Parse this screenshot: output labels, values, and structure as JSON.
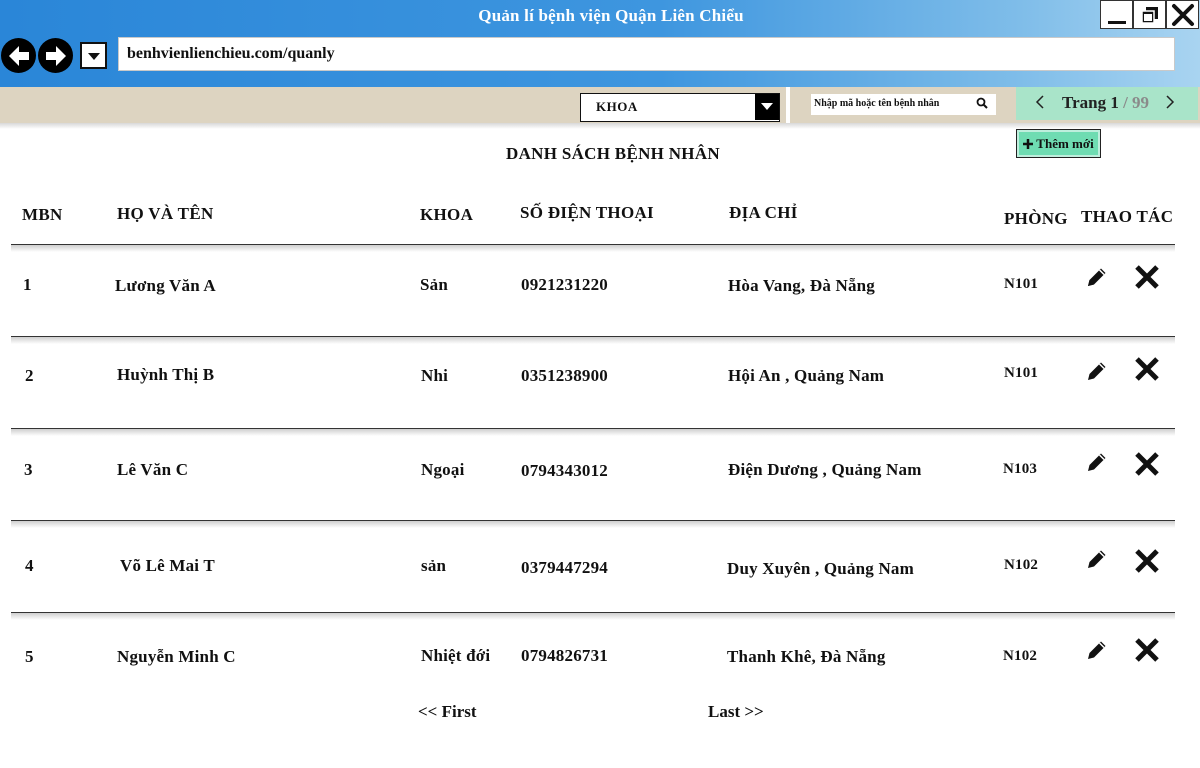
{
  "window": {
    "title": "Quản lí bệnh viện  Quận Liên Chiểu",
    "url": "benhvienlienchieu.com/quanly"
  },
  "filter": {
    "department_label": "KHOA",
    "search_placeholder": "Nhập mã hoặc tên bệnh nhân",
    "page_label": "Trang",
    "page_current": "1",
    "page_total": "/ 99"
  },
  "add_button_label": "Thêm mới",
  "list_title": "DANH SÁCH BỆNH NHÂN",
  "columns": {
    "id": "MBN",
    "name": "HỌ VÀ TÊN",
    "dept": "KHOA",
    "phone": "SỐ ĐIỆN THOẠI",
    "address": "ĐỊA CHỈ",
    "room": "PHÒNG",
    "actions": "THAO TÁC"
  },
  "patients": [
    {
      "id": "1",
      "name": "Lương Văn A",
      "dept": "Sản",
      "phone": "0921231220",
      "address": "Hòa Vang, Đà Nẵng",
      "room": "N101"
    },
    {
      "id": "2",
      "name": "Huỳnh Thị B",
      "dept": "Nhi",
      "phone": "0351238900",
      "address": "Hội An , Quảng Nam",
      "room": "N101"
    },
    {
      "id": "3",
      "name": "Lê  Văn C",
      "dept": "Ngoại",
      "phone": "0794343012",
      "address": "Điện Dương , Quảng Nam",
      "room": "N103"
    },
    {
      "id": "4",
      "name": "Võ Lê Mai T",
      "dept": "sản",
      "phone": "0379447294",
      "address": "Duy Xuyên , Quảng Nam",
      "room": "N102"
    },
    {
      "id": "5",
      "name": "Nguyễn Minh C",
      "dept": "Nhiệt đới",
      "phone": "0794826731",
      "address": "Thanh Khê, Đà Nẵng",
      "room": "N102"
    }
  ],
  "pagination": {
    "first": "<<  First",
    "last": "Last  >>"
  },
  "icons": {
    "back": "arrow-left-icon",
    "forward": "arrow-right-icon",
    "edit": "pencil-icon",
    "delete": "close-x-icon",
    "search": "search-icon"
  },
  "colors": {
    "titlebar": "#2a86d8",
    "filterbar": "#ddd4c1",
    "pager": "#a9e4c9",
    "add_button": "#6fdcb2"
  }
}
